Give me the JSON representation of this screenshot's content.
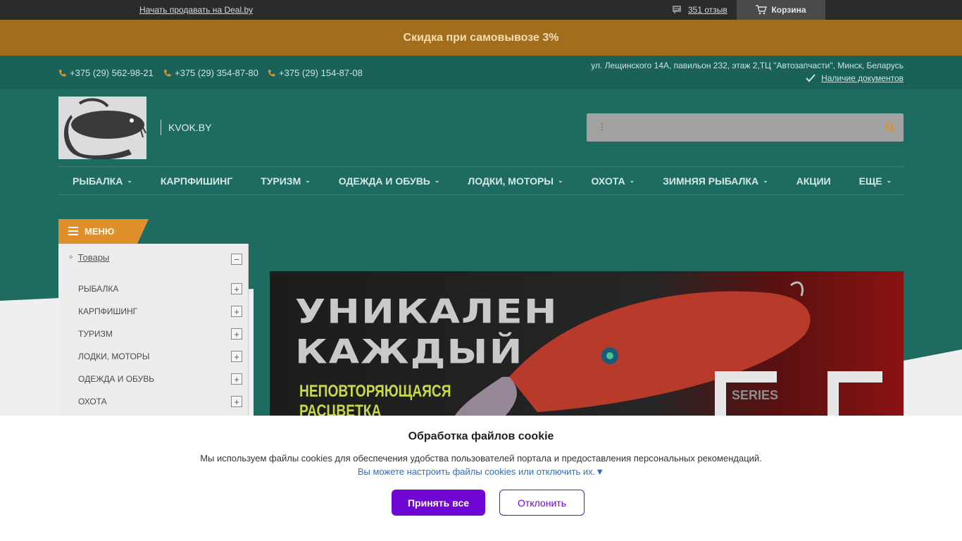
{
  "topbar": {
    "sell_link": "Начать продавать на Deal.by",
    "reviews": "351 отзыв",
    "cart": "Корзина"
  },
  "promo": {
    "text": "Скидка при самовывозе 3%"
  },
  "contacts": {
    "phones": [
      "+375 (29) 562-98-21",
      "+375 (29) 354-87-80",
      "+375 (29) 154-87-08"
    ],
    "address": "ул. Лещинского 14А, павильон 232, этаж 2,ТЦ \"Автозапчасти\", Минск, Беларусь",
    "documents": "Наличие документов"
  },
  "site": {
    "name": "KVOK.BY"
  },
  "search": {
    "placeholder": ""
  },
  "nav": {
    "items": [
      {
        "label": "РЫБАЛКА",
        "has_dropdown": true
      },
      {
        "label": "КАРПФИШИНГ",
        "has_dropdown": false
      },
      {
        "label": "ТУРИЗМ",
        "has_dropdown": true
      },
      {
        "label": "ОДЕЖДА И ОБУВЬ",
        "has_dropdown": true
      },
      {
        "label": "ЛОДКИ, МОТОРЫ",
        "has_dropdown": true
      },
      {
        "label": "ОХОТА",
        "has_dropdown": true
      },
      {
        "label": "ЗИМНЯЯ РЫБАЛКА",
        "has_dropdown": true
      },
      {
        "label": "АКЦИИ",
        "has_dropdown": false
      },
      {
        "label": "ЕЩЕ",
        "has_dropdown": true
      }
    ]
  },
  "menu": {
    "title": "МЕНЮ",
    "root": "Товары",
    "items": [
      "РЫБАЛКА",
      "КАРПФИШИНГ",
      "ТУРИЗМ",
      "ЛОДКИ, МОТОРЫ",
      "ОДЕЖДА И ОБУВЬ",
      "ОХОТА"
    ]
  },
  "banner": {
    "line1": "УНИКАЛЕН",
    "line2": "КАЖДЫЙ",
    "line3": "НЕПОВТОРЯЮЩАЯСЯ",
    "line4": "РАСЦВЕТКА",
    "series": "SERIES"
  },
  "cookie": {
    "title": "Обработка файлов cookie",
    "text": "Мы используем файлы cookies для обеспечения удобства пользователей портала и предоставления персональных рекомендаций.",
    "configure": "Вы можете настроить файлы cookies или отключить их.▼",
    "accept": "Принять все",
    "decline": "Отклонить"
  },
  "colors": {
    "promo_bg": "#a26d1c",
    "header_teal": "#1e6b62",
    "accent_orange": "#e0902a",
    "cookie_button": "#6f06d3"
  }
}
